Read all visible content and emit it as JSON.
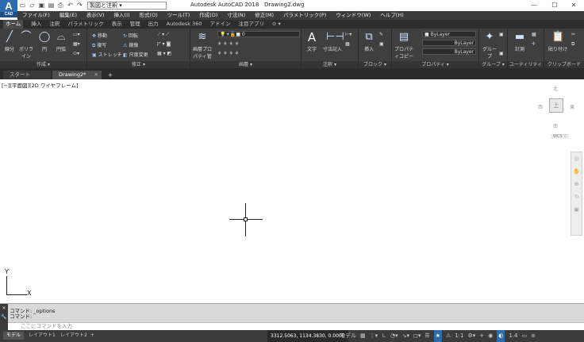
{
  "app": {
    "logo": "A",
    "logo_sub": "CAD",
    "title": "Autodesk AutoCAD 2018",
    "doc": "Drawing2.dwg",
    "workspace": "製図と注釈"
  },
  "menu": [
    "ファイル(F)",
    "編集(E)",
    "表示(V)",
    "挿入(I)",
    "形式(O)",
    "ツール(T)",
    "作成(D)",
    "寸法(N)",
    "修正(M)",
    "パラメトリック(P)",
    "ウィンドウ(W)",
    "ヘルプ(H)"
  ],
  "ribbon_tabs": [
    "ホーム",
    "挿入",
    "注釈",
    "パラメトリック",
    "表示",
    "管理",
    "出力",
    "Autodesk 360",
    "アドイン",
    "注目アプリ",
    "⊙ ▾"
  ],
  "ribbon": {
    "draw": {
      "label": "作成 ▾",
      "line": "線分",
      "polyline": "ポリライン",
      "circle": "円",
      "arc": "円弧"
    },
    "modify": {
      "label": "修正 ▾",
      "move": "移動",
      "copy": "複写",
      "stretch": "ストレッチ",
      "rotate": "回転",
      "mirror": "鏡像",
      "scale": "尺度変更"
    },
    "layers": {
      "label": "画層 ▾",
      "layer_props": "画層プロパティ管理",
      "current": "0"
    },
    "annotation": {
      "label": "注釈 ▾",
      "text": "文字",
      "dim": "寸法記入"
    },
    "block": {
      "label": "ブロック ▾",
      "insert": "挿入"
    },
    "properties": {
      "label": "プロパティ ▾",
      "match": "プロパティコピー",
      "color": "ByLayer",
      "linetype": "ByLayer",
      "lineweight": "ByLayer"
    },
    "groups": {
      "label": "グループ ▾",
      "group": "グループ"
    },
    "utilities": {
      "label": "ユーティリティ ▾",
      "measure": "計測"
    },
    "clipboard": {
      "label": "クリップボード",
      "paste": "貼り付け"
    }
  },
  "doc_tabs": {
    "start": "スタート",
    "drawing": "Drawing2*"
  },
  "canvas": {
    "view_label": "[−][平面図][2D ワイヤフレーム]",
    "vc_n": "北",
    "vc_s": "南",
    "vc_w": "西",
    "vc_e": "東",
    "vc_top": "上",
    "wcs": "WCS ▽",
    "ucs_x": "X",
    "ucs_y": "Y"
  },
  "command": {
    "line1": "コマンド:  _options",
    "line2": "コマンド:",
    "placeholder": "ここにコマンドを入力"
  },
  "status": {
    "model": "モデル",
    "layout1": "レイアウト1",
    "layout2": "レイアウト2",
    "coords": "3312.5063, 1134.3830, 0.0000",
    "model_btn": "モデル",
    "scale": "1:1",
    "zoom": "1.4"
  }
}
